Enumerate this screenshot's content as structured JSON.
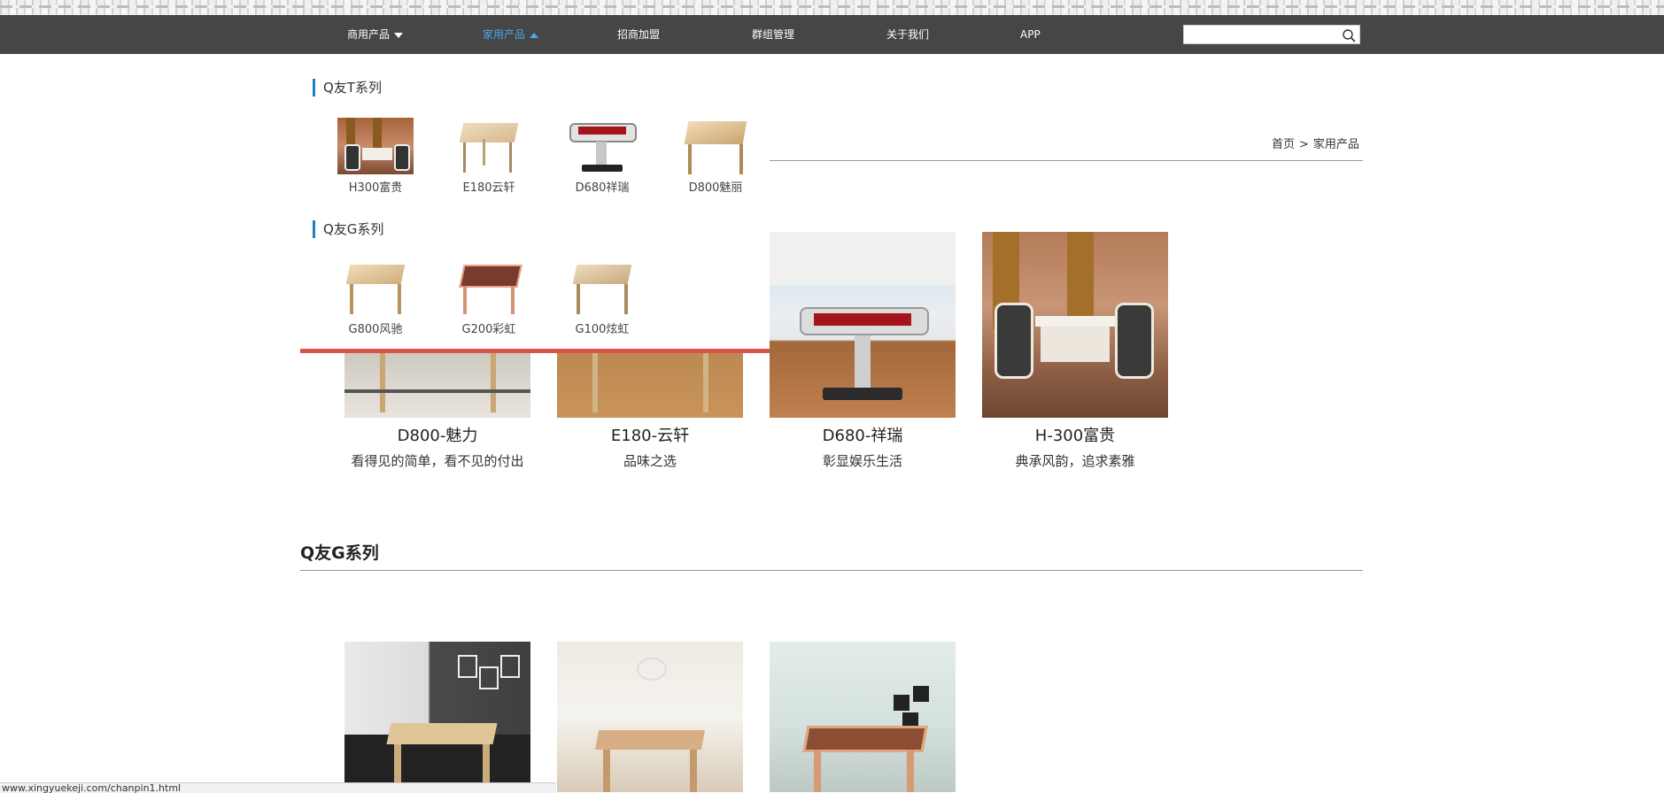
{
  "nav": {
    "items": [
      {
        "label": "商用产品"
      },
      {
        "label": "家用产品"
      },
      {
        "label": "招商加盟"
      },
      {
        "label": "群组管理"
      },
      {
        "label": "关于我们"
      },
      {
        "label": "APP"
      }
    ],
    "search_value": ""
  },
  "breadcrumb": {
    "home": "首页",
    "separator": ">",
    "current": "家用产品"
  },
  "dropdown": {
    "groups": [
      {
        "title": "Q友T系列",
        "items": [
          "H300富贵",
          "E180云轩",
          "D680祥瑞",
          "D800魅丽"
        ]
      },
      {
        "title": "Q友G系列",
        "items": [
          "G800风驰",
          "G200彩虹",
          "G100炫虹"
        ]
      }
    ]
  },
  "products": [
    {
      "name": "D800-魅力",
      "desc": "看得见的简单，看不见的付出"
    },
    {
      "name": "E180-云轩",
      "desc": "品味之选"
    },
    {
      "name": "D680-祥瑞",
      "desc": "彰显娱乐生活"
    },
    {
      "name": "H-300富贵",
      "desc": "典承风韵，追求素雅"
    }
  ],
  "section": {
    "title": "Q友G系列"
  },
  "status_bar": {
    "url": "www.xingyuekeji.com/chanpin1.html"
  },
  "colors": {
    "nav_bg": "#464646",
    "accent_blue": "#4aa8e8",
    "dropdown_border": "#d9534f"
  }
}
